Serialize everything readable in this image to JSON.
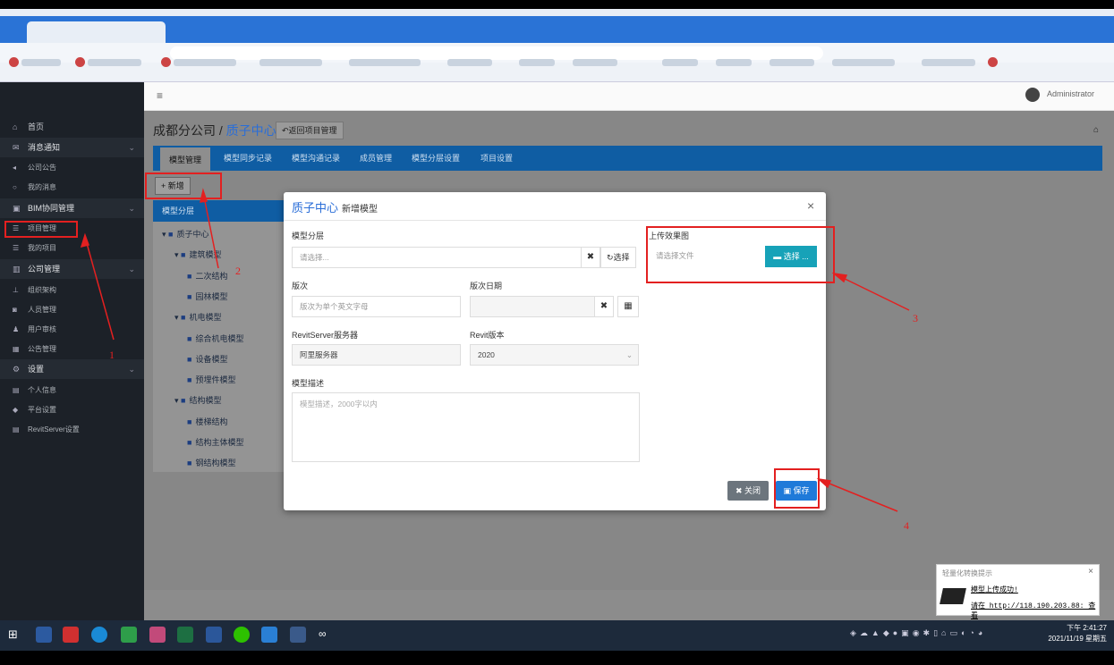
{
  "sidebar": {
    "items": [
      {
        "label": "首页",
        "icon": "home-icon"
      },
      {
        "label": "消息通知",
        "icon": "envelope-icon"
      },
      {
        "label": "公司公告",
        "icon": "bullhorn-icon"
      },
      {
        "label": "我的消息",
        "icon": "comment-icon"
      },
      {
        "label": "BIM协同管理",
        "icon": "cube-icon"
      },
      {
        "label": "项目管理",
        "icon": "list-icon"
      },
      {
        "label": "我的项目",
        "icon": "list-icon"
      },
      {
        "label": "公司管理",
        "icon": "bank-icon"
      },
      {
        "label": "组织架构",
        "icon": "sitemap-icon"
      },
      {
        "label": "人员管理",
        "icon": "user-icon"
      },
      {
        "label": "用户审核",
        "icon": "user-check-icon"
      },
      {
        "label": "公告管理",
        "icon": "calendar-icon"
      },
      {
        "label": "设置",
        "icon": "gear-icon"
      },
      {
        "label": "个人信息",
        "icon": "id-card-icon"
      },
      {
        "label": "平台设置",
        "icon": "tag-icon"
      },
      {
        "label": "RevitServer设置",
        "icon": "server-icon"
      }
    ]
  },
  "header": {
    "user": "Administrator",
    "menu_icon": "≡"
  },
  "page": {
    "company": "成都分公司 /",
    "project": "质子中心",
    "back_label": "返回项目管理",
    "tabs": [
      "模型管理",
      "模型同步记录",
      "模型沟通记录",
      "成员管理",
      "模型分层设置",
      "项目设置"
    ],
    "add_label": "+ 新增",
    "tree_header": "模型分层"
  },
  "tree": [
    {
      "label": "质子中心",
      "level": 0,
      "expanded": true
    },
    {
      "label": "建筑模型",
      "level": 1,
      "expanded": true
    },
    {
      "label": "二次结构",
      "level": 2
    },
    {
      "label": "园林模型",
      "level": 2
    },
    {
      "label": "机电模型",
      "level": 1,
      "expanded": true
    },
    {
      "label": "综合机电模型",
      "level": 2
    },
    {
      "label": "设备模型",
      "level": 2
    },
    {
      "label": "预埋件模型",
      "level": 2
    },
    {
      "label": "结构模型",
      "level": 1,
      "expanded": true
    },
    {
      "label": "楼梯结构",
      "level": 2
    },
    {
      "label": "结构主体模型",
      "level": 2
    },
    {
      "label": "钢结构模型",
      "level": 2
    }
  ],
  "modal": {
    "title_project": "质子中心",
    "title_text": "新增模型",
    "layer_label": "模型分层",
    "layer_placeholder": "请选择...",
    "layer_select": "选择",
    "upload_label": "上传效果图",
    "upload_placeholder": "请选择文件",
    "upload_button": "选择 ...",
    "version_label": "版次",
    "version_placeholder": "版次为单个英文字母",
    "date_label": "版次日期",
    "server_label": "RevitServer服务器",
    "server_value": "阿里服务器",
    "revit_label": "Revit版本",
    "revit_value": "2020",
    "desc_label": "模型描述",
    "desc_placeholder": "模型描述，2000字以内",
    "close_label": "关闭",
    "save_label": "保存"
  },
  "annotations": [
    "1",
    "2",
    "3",
    "4"
  ],
  "toast": {
    "title": "轻量化转换提示",
    "line1": "模型上传成功!",
    "line2": "请在 http://118.190.203.88: 查看"
  },
  "clock": {
    "time": "下午 2:41:27",
    "date": "2021/11/19 星期五"
  },
  "colors": {
    "accent": "#0f5da3",
    "link": "#2a6ed8",
    "upload": "#17a2b8",
    "save": "#1f7ad9",
    "annotation": "#e32020"
  }
}
